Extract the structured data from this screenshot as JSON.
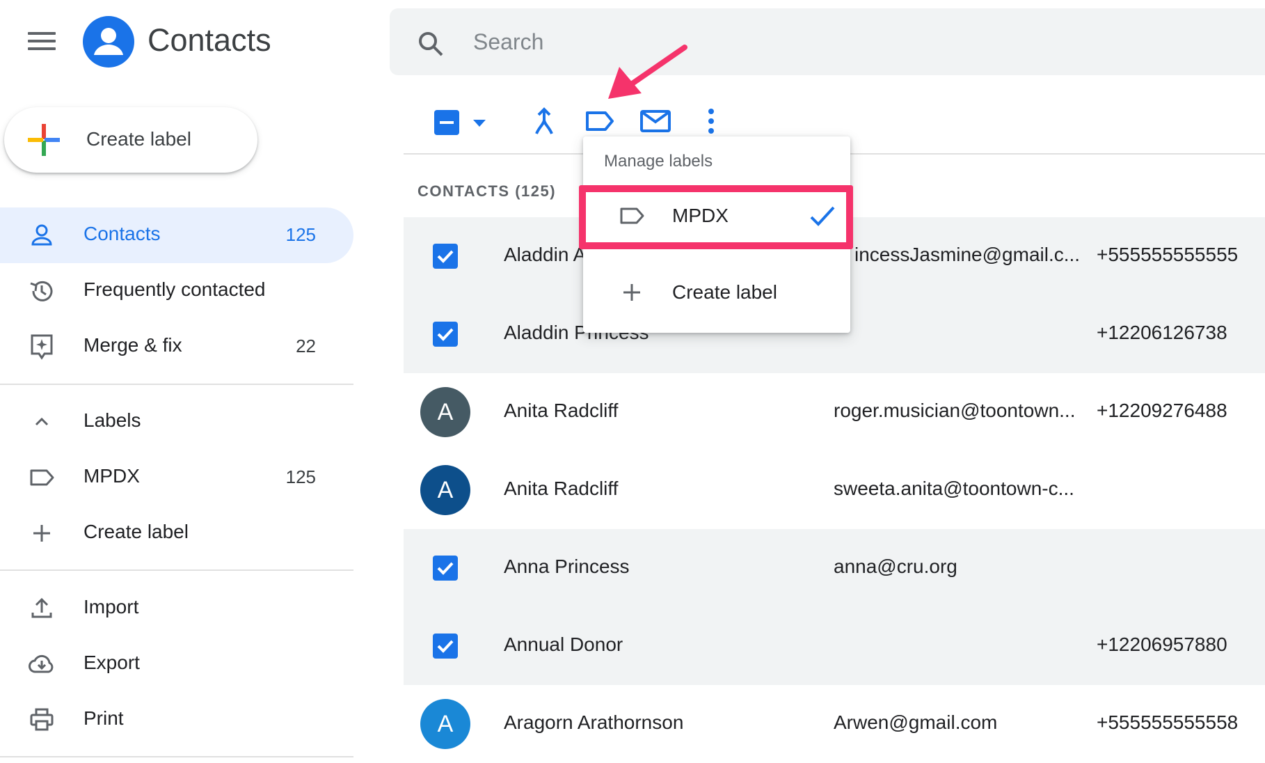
{
  "app": {
    "title": "Contacts"
  },
  "sidebar": {
    "create_label": "Create label",
    "nav": [
      {
        "label": "Contacts",
        "count": "125"
      },
      {
        "label": "Frequently contacted",
        "count": ""
      },
      {
        "label": "Merge & fix",
        "count": "22"
      }
    ],
    "labels_header": "Labels",
    "labels": [
      {
        "label": "MPDX",
        "count": "125"
      }
    ],
    "bottom": [
      {
        "label": "Import"
      },
      {
        "label": "Export"
      },
      {
        "label": "Print"
      }
    ]
  },
  "search": {
    "placeholder": "Search"
  },
  "list": {
    "header": "CONTACTS (125)",
    "rows": [
      {
        "name": "Aladdin A",
        "email": "incessJasmine@gmail.c...",
        "phone": "+555555555555",
        "selected": true
      },
      {
        "name": "Aladdin Princess",
        "email": "",
        "phone": "+12206126738",
        "selected": true
      },
      {
        "name": "Anita Radcliff",
        "email": "roger.musician@toontown...",
        "phone": "+12209276488",
        "selected": false,
        "initial": "A",
        "color": "#455a64"
      },
      {
        "name": "Anita Radcliff",
        "email": "sweeta.anita@toontown-c...",
        "phone": "",
        "selected": false,
        "initial": "A",
        "color": "#0d4f8b"
      },
      {
        "name": "Anna Princess",
        "email": "anna@cru.org",
        "phone": "",
        "selected": true
      },
      {
        "name": "Annual Donor",
        "email": "",
        "phone": "+12206957880",
        "selected": true
      },
      {
        "name": "Aragorn Arathornson",
        "email": "Arwen@gmail.com",
        "phone": "+555555555558",
        "selected": false,
        "initial": "A",
        "color": "#1a88d6"
      }
    ]
  },
  "menu": {
    "header": "Manage labels",
    "items": [
      {
        "label": "MPDX",
        "checked": true
      },
      {
        "label": "Create label"
      }
    ]
  },
  "colors": {
    "accent": "#1a73e8",
    "highlight": "#f5336b"
  }
}
